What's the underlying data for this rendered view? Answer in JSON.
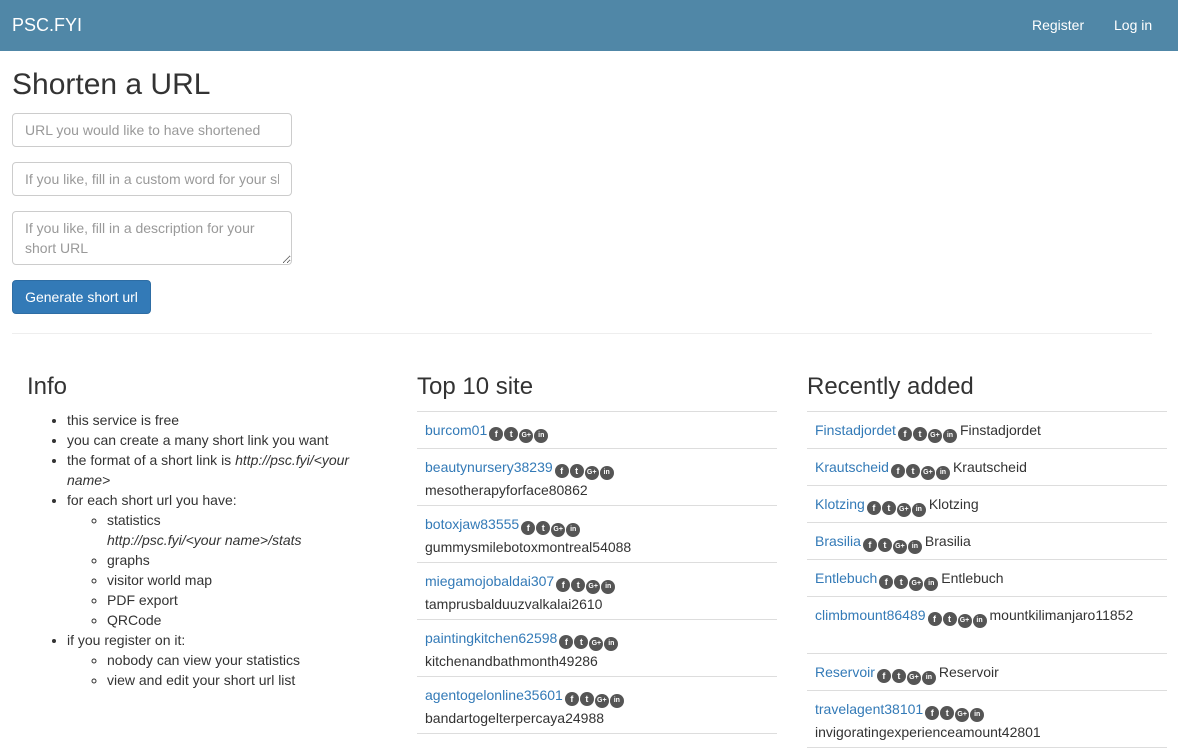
{
  "nav": {
    "brand": "PSC.FYI",
    "register": "Register",
    "login": "Log in"
  },
  "form": {
    "title": "Shorten a URL",
    "url_placeholder": "URL you would like to have shortened",
    "custom_placeholder": "If you like, fill in a custom word for your short URL",
    "description_placeholder": "If you like, fill in a description for your short URL",
    "submit_label": "Generate short url"
  },
  "info": {
    "title": "Info",
    "items": {
      "free": "this service is free",
      "many": "you can create a many short link you want",
      "format_prefix": "the format of a short link is ",
      "format_value": "http://psc.fyi/<your name>",
      "each": "for each short url you have:",
      "statistics": "statistics",
      "statistics_url": "http://psc.fyi/<your name>/stats",
      "graphs": "graphs",
      "map": "visitor world map",
      "pdf": "PDF export",
      "qrcode": "QRCode",
      "register": "if you register on it:",
      "nobody": "nobody can view your statistics",
      "edit": "view and edit your short url list"
    }
  },
  "share_icons": [
    "facebook-icon",
    "twitter-icon",
    "google-plus-icon",
    "linkedin-icon"
  ],
  "top10": {
    "title": "Top 10 site",
    "rows": [
      {
        "name": "burcom01",
        "desc": ""
      },
      {
        "name": "beautynursery38239",
        "desc": "mesotherapyforface80862"
      },
      {
        "name": "botoxjaw83555",
        "desc": "gummysmilebotoxmontreal54088"
      },
      {
        "name": "miegamojobaldai307",
        "desc": "tamprusbalduuzvalkalai2610"
      },
      {
        "name": "paintingkitchen62598",
        "desc": "kitchenandbathmonth49286"
      },
      {
        "name": "agentogelonline35601",
        "desc": "bandartogelterpercaya24988"
      }
    ]
  },
  "recent": {
    "title": "Recently added",
    "rows": [
      {
        "name": "Finstadjordet",
        "desc": "Finstadjordet"
      },
      {
        "name": "Krautscheid",
        "desc": "Krautscheid"
      },
      {
        "name": "Klotzing",
        "desc": "Klotzing"
      },
      {
        "name": "Brasilia",
        "desc": "Brasilia"
      },
      {
        "name": "Entlebuch",
        "desc": "Entlebuch"
      },
      {
        "name": "climbmount86489",
        "desc": "mountkilimanjaro11852"
      },
      {
        "name": "Reservoir",
        "desc": "Reservoir"
      },
      {
        "name": "travelagent38101",
        "desc": "invigoratingexperienceamount42801"
      }
    ]
  },
  "colors": {
    "navbar": "#5087a7",
    "link": "#337ab7",
    "button": "#337ab7",
    "icon": "#555555"
  }
}
